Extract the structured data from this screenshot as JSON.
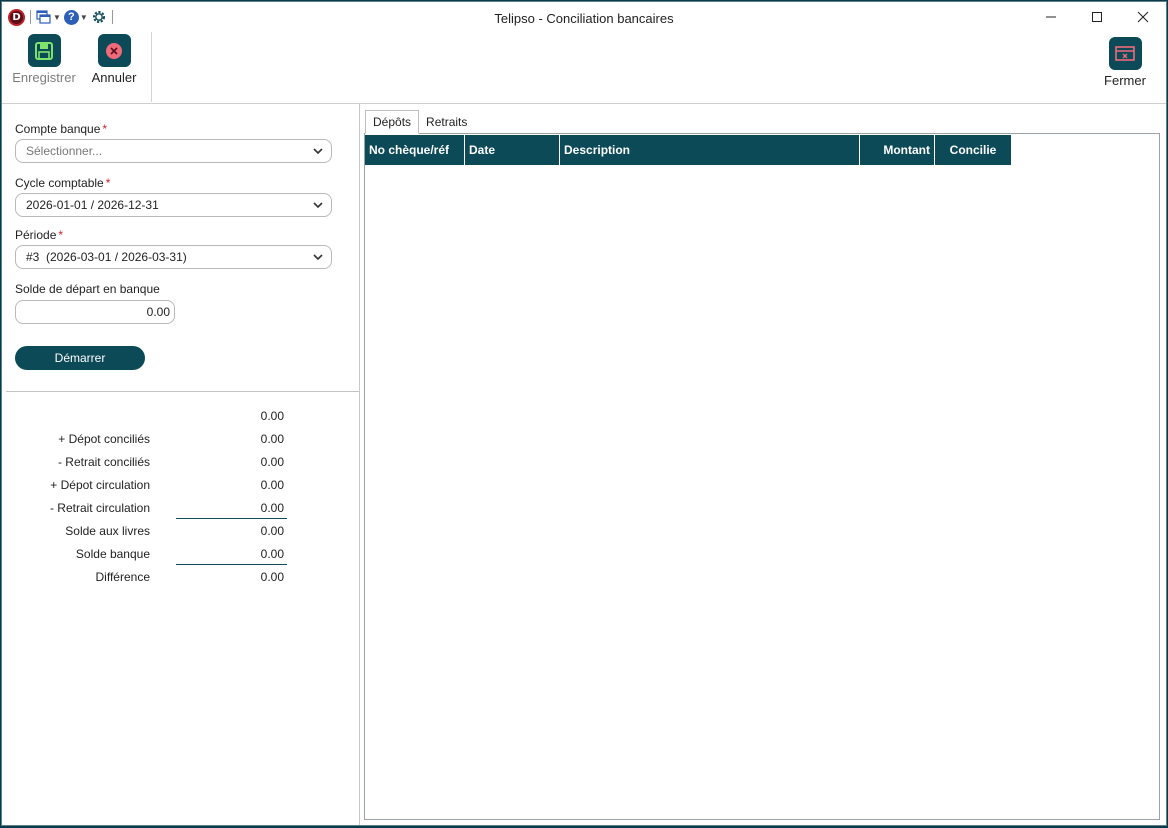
{
  "window": {
    "title": "Telipso - Conciliation bancaires",
    "app_logo_letter": "D",
    "controls": {
      "minimize_icon": "minimize-icon",
      "maximize_icon": "maximize-icon",
      "close_icon": "close-icon"
    }
  },
  "toolbar": {
    "save_label": "Enregistrer",
    "cancel_label": "Annuler",
    "close_label": "Fermer"
  },
  "form": {
    "bank_account": {
      "label": "Compte banque",
      "required": "*",
      "placeholder": "Sélectionner..."
    },
    "fiscal_cycle": {
      "label": "Cycle comptable",
      "required": "*",
      "value": "2026-01-01 / 2026-12-31"
    },
    "period": {
      "label": "Période",
      "required": "*",
      "value": "#3  (2026-03-01 / 2026-03-31)"
    },
    "opening_balance": {
      "label": "Solde de départ en banque",
      "value": "0.00"
    },
    "start_label": "Démarrer"
  },
  "summary": [
    {
      "label": "",
      "value": "0.00"
    },
    {
      "label": "+ Dépot conciliés",
      "value": "0.00"
    },
    {
      "label": "- Retrait conciliés",
      "value": "0.00"
    },
    {
      "label": "+ Dépot circulation",
      "value": "0.00"
    },
    {
      "label": "- Retrait circulation",
      "value": "0.00"
    },
    {
      "label": "Solde aux livres",
      "value": "0.00"
    },
    {
      "label": "Solde banque",
      "value": "0.00"
    },
    {
      "label": "Différence",
      "value": "0.00"
    }
  ],
  "tabs": [
    {
      "label": "Dépôts",
      "active": true
    },
    {
      "label": "Retraits",
      "active": false
    }
  ],
  "grid": {
    "columns": [
      "No chèque/réf",
      "Date",
      "Description",
      "Montant",
      "Concilie"
    ],
    "rows": []
  },
  "colors": {
    "accent": "#0d4a58",
    "required": "#d0202a",
    "frame": "#0b3a4a"
  }
}
